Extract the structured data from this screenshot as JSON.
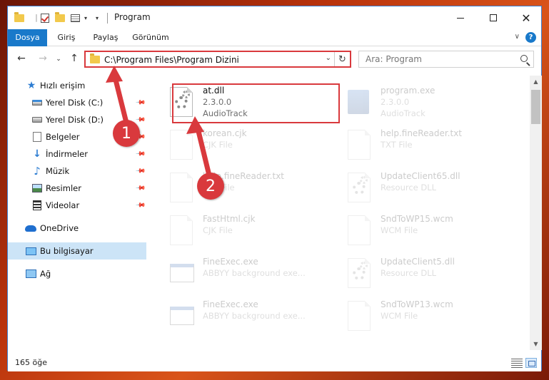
{
  "titlebar": {
    "title": "Program",
    "qa_icons": [
      "folder-icon",
      "properties-check-icon",
      "new-folder-icon",
      "properties-icon",
      "dropdown-caret-icon"
    ],
    "minimize_label": "minimize",
    "maximize_label": "maximize",
    "close_label": "✕"
  },
  "ribbon": {
    "tabs": [
      {
        "label": "Dosya"
      },
      {
        "label": "Giriş"
      },
      {
        "label": "Paylaş"
      },
      {
        "label": "Görünüm"
      }
    ],
    "help_label": "?"
  },
  "navigation": {
    "back": "←",
    "forward": "→",
    "recent": "⌄",
    "up": "↑",
    "address_path": "C:\\Program Files\\Program Dizini",
    "search_placeholder": "Ara: Program"
  },
  "sidebar": {
    "items": [
      {
        "label": "Hızlı erişim",
        "icon": "star-icon",
        "pinned": false
      },
      {
        "label": "Yerel Disk (C:)",
        "icon": "drive-c-icon",
        "pinned": true
      },
      {
        "label": "Yerel Disk (D:)",
        "icon": "drive-d-icon",
        "pinned": true
      },
      {
        "label": "Belgeler",
        "icon": "documents-icon",
        "pinned": true
      },
      {
        "label": "İndirmeler",
        "icon": "downloads-icon",
        "pinned": true
      },
      {
        "label": "Müzik",
        "icon": "music-icon",
        "pinned": true
      },
      {
        "label": "Resimler",
        "icon": "pictures-icon",
        "pinned": true
      },
      {
        "label": "Videolar",
        "icon": "videos-icon",
        "pinned": true
      },
      {
        "label": "OneDrive",
        "icon": "onedrive-icon",
        "pinned": false
      },
      {
        "label": "Bu bilgisayar",
        "icon": "this-pc-icon",
        "pinned": false,
        "selected": true
      },
      {
        "label": "Ağ",
        "icon": "network-icon",
        "pinned": false
      }
    ]
  },
  "files": [
    {
      "name": "at.dll",
      "line2": "2.3.0.0",
      "line3": "AudioTrack",
      "icon": "dll-gear-icon",
      "highlighted": true
    },
    {
      "name": "program.exe",
      "line2": "2.3.0.0",
      "line3": "AudioTrack",
      "icon": "program-exe-icon"
    },
    {
      "name": "korean.cjk",
      "line2": "CJK File",
      "icon": "generic-file-icon"
    },
    {
      "name": "help.fineReader.txt",
      "line2": "TXT File",
      "icon": "generic-file-icon"
    },
    {
      "name": "help.fineReader.txt",
      "line2": "TXT File",
      "icon": "generic-file-icon"
    },
    {
      "name": "UpdateClient65.dll",
      "line2": "Resource DLL",
      "icon": "dll-gear-icon"
    },
    {
      "name": "FastHtml.cjk",
      "line2": "CJK File",
      "icon": "generic-file-icon"
    },
    {
      "name": "SndToWP15.wcm",
      "line2": "WCM File",
      "icon": "generic-file-icon"
    },
    {
      "name": "FineExec.exe",
      "line2": "ABBYY background exe...",
      "icon": "exe-window-icon"
    },
    {
      "name": "UpdateClient5.dll",
      "line2": "Resource DLL",
      "icon": "dll-gear-icon"
    },
    {
      "name": "FineExec.exe",
      "line2": "ABBYY background exe...",
      "icon": "exe-window-icon"
    },
    {
      "name": "SndToWP13.wcm",
      "line2": "WCM File",
      "icon": "generic-file-icon"
    }
  ],
  "status": {
    "item_count": "165 öğe"
  },
  "annotations": {
    "callout_1": "1",
    "callout_2": "2",
    "accent_color": "#d9393d"
  }
}
